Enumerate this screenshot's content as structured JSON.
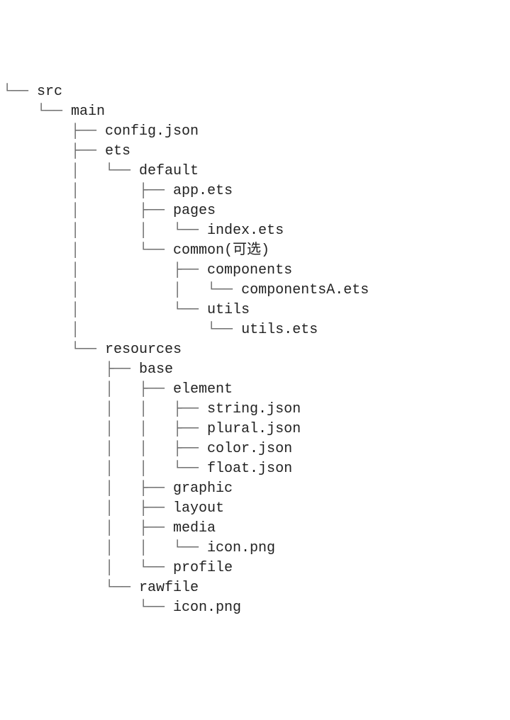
{
  "lines": [
    {
      "prefix": "└── ",
      "name": "src"
    },
    {
      "prefix": "    └── ",
      "name": "main"
    },
    {
      "prefix": "        ├── ",
      "name": "config.json"
    },
    {
      "prefix": "        ├── ",
      "name": "ets"
    },
    {
      "prefix": "        │   └── ",
      "name": "default"
    },
    {
      "prefix": "        │       ├── ",
      "name": "app.ets"
    },
    {
      "prefix": "        │       ├── ",
      "name": "pages"
    },
    {
      "prefix": "        │       │   └── ",
      "name": "index.ets"
    },
    {
      "prefix": "        │       └── ",
      "name": "common(可选)"
    },
    {
      "prefix": "        │           ├── ",
      "name": "components"
    },
    {
      "prefix": "        │           │   └── ",
      "name": "componentsA.ets"
    },
    {
      "prefix": "        │           └── ",
      "name": "utils"
    },
    {
      "prefix": "        │               └── ",
      "name": "utils.ets"
    },
    {
      "prefix": "        └── ",
      "name": "resources"
    },
    {
      "prefix": "            ├── ",
      "name": "base"
    },
    {
      "prefix": "            │   ├── ",
      "name": "element"
    },
    {
      "prefix": "            │   │   ├── ",
      "name": "string.json"
    },
    {
      "prefix": "            │   │   ├── ",
      "name": "plural.json"
    },
    {
      "prefix": "            │   │   ├── ",
      "name": "color.json"
    },
    {
      "prefix": "            │   │   └── ",
      "name": "float.json"
    },
    {
      "prefix": "            │   ├── ",
      "name": "graphic"
    },
    {
      "prefix": "            │   ├── ",
      "name": "layout"
    },
    {
      "prefix": "            │   ├── ",
      "name": "media"
    },
    {
      "prefix": "            │   │   └── ",
      "name": "icon.png"
    },
    {
      "prefix": "            │   └── ",
      "name": "profile"
    },
    {
      "prefix": "            └── ",
      "name": "rawfile"
    },
    {
      "prefix": "                └── ",
      "name": "icon.png"
    }
  ]
}
